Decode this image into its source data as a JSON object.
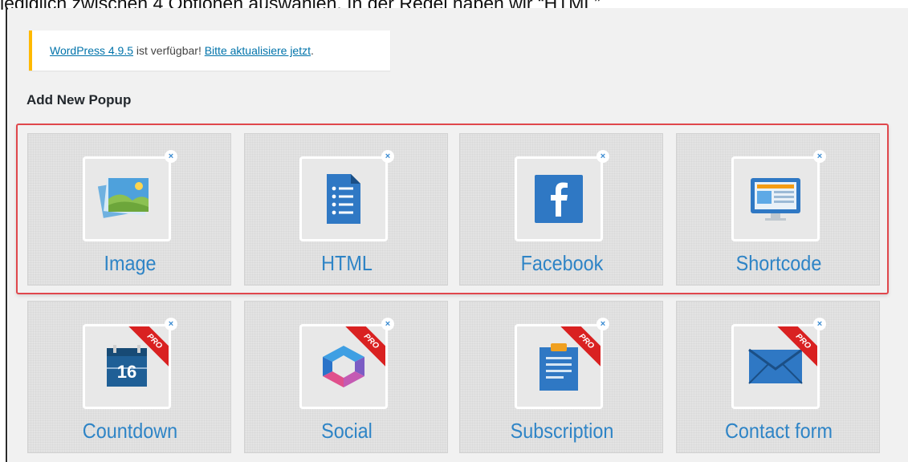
{
  "top_text": "lediglich zwischen 4 Optionen auswählen. In der Regel haben wir “HTML”",
  "notice": {
    "link_version": "WordPress 4.9.5",
    "middle_text": " ist verfügbar! ",
    "link_update": "Bitte aktualisiere jetzt",
    "end_text": "."
  },
  "page_title": "Add New Popup",
  "close_glyph": "×",
  "pro_label": "PRO",
  "colors": {
    "accent_blue": "#2e84c6",
    "highlight_red": "#e0474c",
    "notice_yellow": "#ffb900",
    "pro_red": "#d92121"
  },
  "popup_types": [
    {
      "label": "Image",
      "icon": "image-icon",
      "pro": false
    },
    {
      "label": "HTML",
      "icon": "document-icon",
      "pro": false
    },
    {
      "label": "Facebook",
      "icon": "facebook-icon",
      "pro": false
    },
    {
      "label": "Shortcode",
      "icon": "monitor-icon",
      "pro": false
    },
    {
      "label": "Countdown",
      "icon": "calendar-icon",
      "pro": true,
      "icon_text": "16"
    },
    {
      "label": "Social",
      "icon": "share-icon",
      "pro": true
    },
    {
      "label": "Subscription",
      "icon": "clipboard-icon",
      "pro": true
    },
    {
      "label": "Contact form",
      "icon": "envelope-icon",
      "pro": true
    }
  ]
}
